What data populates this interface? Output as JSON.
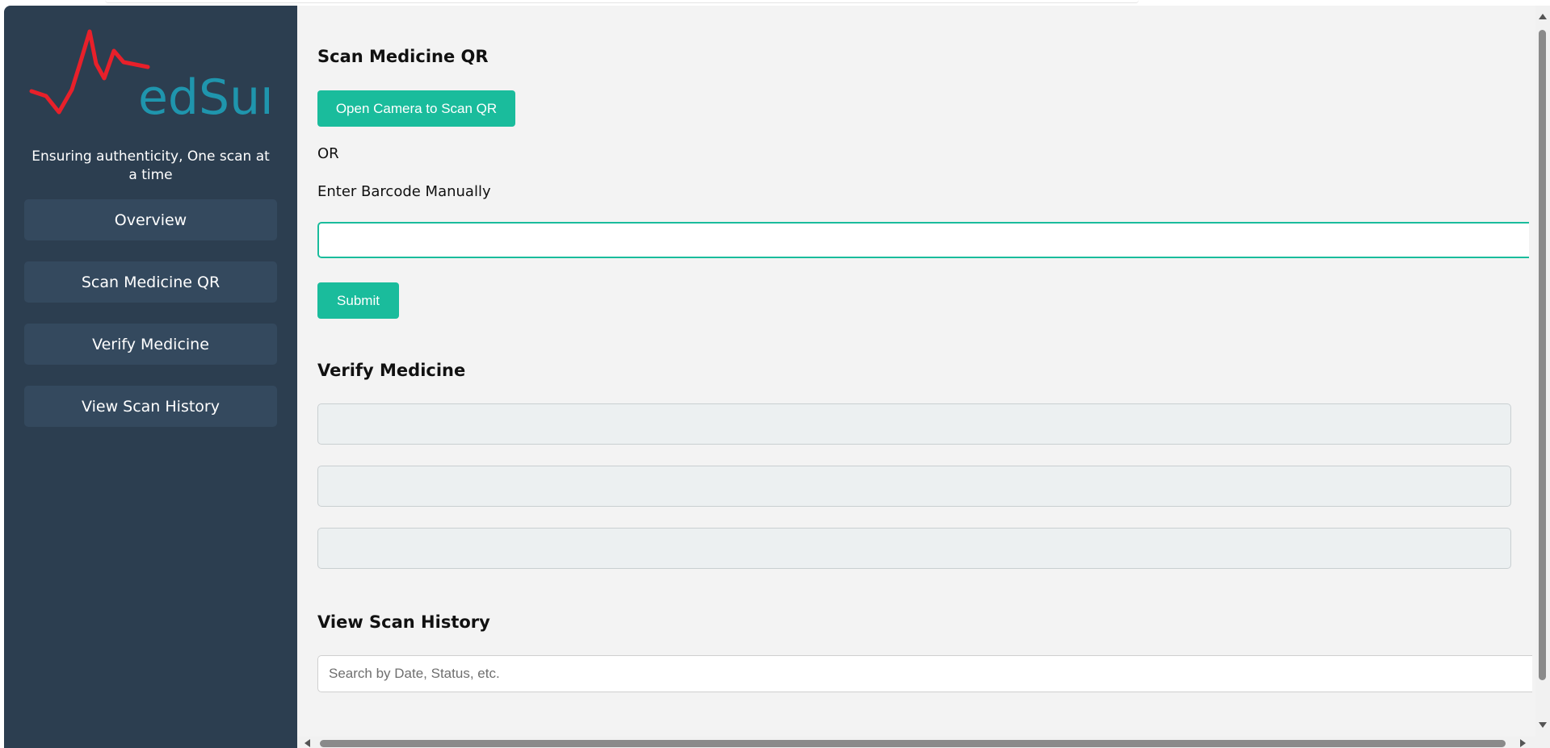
{
  "sidebar": {
    "logo_text": "edSure",
    "tagline": "Ensuring authenticity, One scan at a time",
    "items": [
      {
        "label": "Overview"
      },
      {
        "label": "Scan Medicine QR"
      },
      {
        "label": "Verify Medicine"
      },
      {
        "label": "View Scan History"
      }
    ]
  },
  "scan": {
    "title": "Scan Medicine QR",
    "camera_button": "Open Camera to Scan QR",
    "or_text": "OR",
    "manual_label": "Enter Barcode Manually",
    "barcode_value": "",
    "submit_button": "Submit"
  },
  "verify": {
    "title": "Verify Medicine"
  },
  "history": {
    "title": "View Scan History",
    "search_placeholder": "Search by Date, Status, etc."
  },
  "colors": {
    "sidebar_bg": "#2c3e50",
    "nav_item_bg": "#34495e",
    "accent": "#1abc9c",
    "logo_red": "#e8202a",
    "logo_teal": "#1f95ad",
    "page_bg": "#f3f3f3",
    "verify_box_bg": "#ecf0f1"
  },
  "icons": {
    "logo": "heartbeat-m-logo",
    "scroll_up": "arrow-up-icon",
    "scroll_down": "arrow-down-icon",
    "scroll_left": "arrow-left-icon",
    "scroll_right": "arrow-right-icon"
  }
}
